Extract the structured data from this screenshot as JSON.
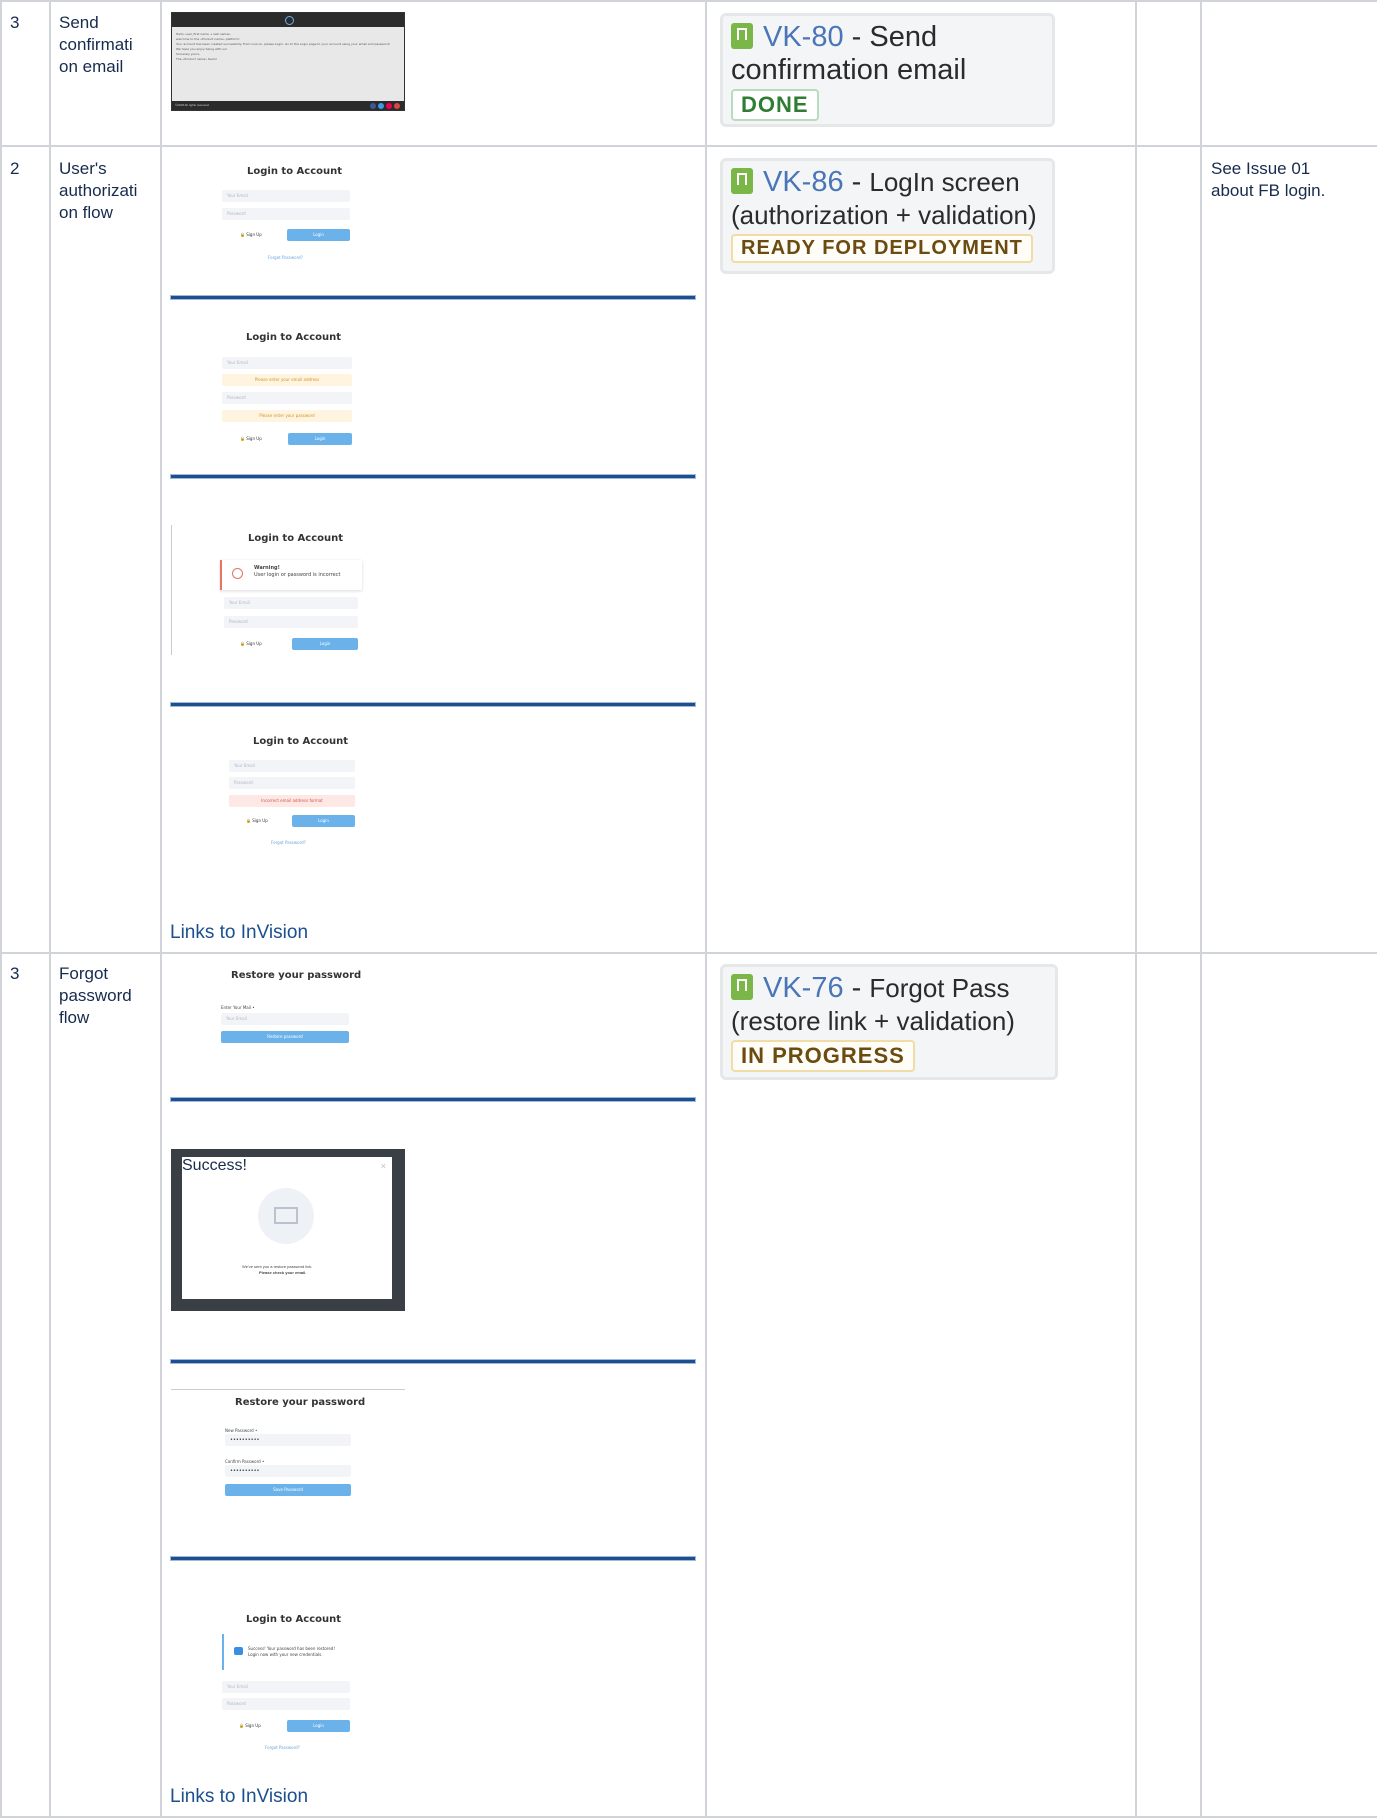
{
  "rows": [
    {
      "number": "3",
      "title_lines": [
        "Send",
        "confirmati",
        "on email"
      ],
      "jira_key": "VK-80",
      "jira_title_line1": "Send",
      "jira_title_line2": "confirmation email",
      "jira_status": "DONE",
      "note_lines": []
    },
    {
      "number": "2",
      "title_lines": [
        "User's",
        "authorizati",
        "on flow"
      ],
      "jira_key": "VK-86",
      "jira_title_line1": "LogIn screen",
      "jira_title_line2": "(authorization + validation)",
      "jira_status": "READY FOR DEPLOYMENT",
      "note_lines": [
        "See Issue 01",
        "about FB login."
      ],
      "link": "Links to InVision"
    },
    {
      "number": "3",
      "title_lines": [
        "Forgot",
        "password",
        "flow"
      ],
      "jira_key": "VK-76",
      "jira_title_line1": "Forgot Pass",
      "jira_title_line2": "(restore  link + validation)",
      "jira_status": "IN PROGRESS",
      "note_lines": [],
      "link": "Links to InVision"
    }
  ],
  "mockups": {
    "login_title": "Login to Account",
    "email_placeholder": "Your Email",
    "password_placeholder": "Password",
    "sign_up": "Sign Up",
    "login": "Login",
    "forgot": "Forgot Password?",
    "warn_email": "Please enter your email address",
    "warn_password": "Please enter your password",
    "warning_title": "Warning!",
    "warning_text": "User login or password is incorrect",
    "err_format": "Incorrect email address format",
    "restore_title": "Restore your password",
    "enter_mail": "Enter Your Mail •",
    "restore_btn": "Restore password",
    "success_title": "Success!",
    "success_text1": "We've sent you a restore password link.",
    "success_text2": "Please check your email.",
    "new_password": "New Password •",
    "confirm_password": "Confirm Password •",
    "dots": "••••••••••",
    "save_password": "Save Password",
    "restored_text1": "Success! Your password has been restored!",
    "restored_text2": "Login now with your new credentials.",
    "email_lines": [
      "Hello, user_first name + last names,",
      "welcome to the «Product name» platform!",
      "Your account has been created successfully. From now on, please Login. Go to the Login page to your account using your email and password!",
      "We hope you enjoy being with us!",
      "Sincerely yours,",
      "The «Product name» team!"
    ],
    "email_footer": "©2018 All rights reserved."
  }
}
